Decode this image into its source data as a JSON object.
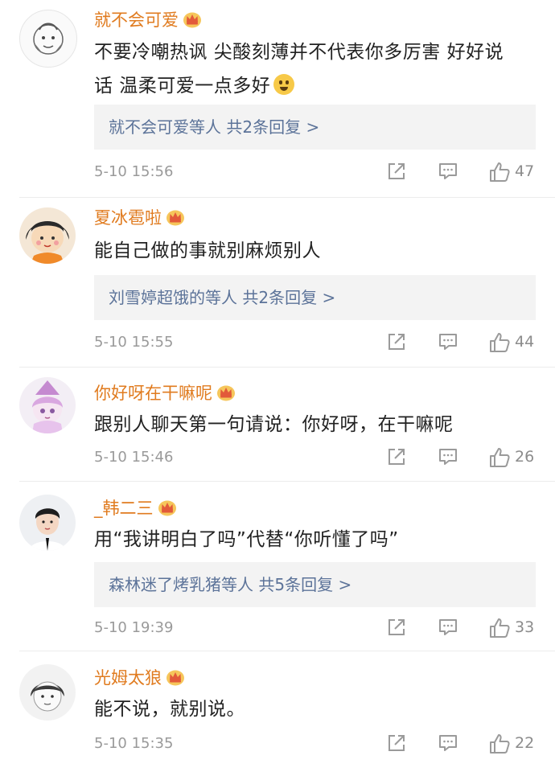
{
  "comments": [
    {
      "username": "就不会可爱",
      "text_line1": "不要冷嘲热讽 尖酸刻薄并不代表你多厉害 好好说",
      "text_line2": "话 温柔可爱一点多好",
      "replies": "就不会可爱等人  共2条回复 >",
      "time": "5-10 15:56",
      "likes": "47",
      "avatar_icon": "doodle-face-avatar"
    },
    {
      "username": "夏冰雹啦",
      "text_line1": "能自己做的事就别麻烦别人",
      "replies": "刘雪婷超饿的等人  共2条回复 >",
      "time": "5-10 15:55",
      "likes": "44",
      "avatar_icon": "cartoon-girl-avatar"
    },
    {
      "username": "你好呀在干嘛呢",
      "text_line1": "跟别人聊天第一句请说：你好呀，在干嘛呢",
      "time": "5-10 15:46",
      "likes": "26",
      "avatar_icon": "anime-character-avatar"
    },
    {
      "username": "_韩二三",
      "text_line1": "用“我讲明白了吗”代替“你听懂了吗”",
      "replies": "森林迷了烤乳猪等人  共5条回复 >",
      "time": "5-10 19:39",
      "likes": "33",
      "avatar_icon": "person-photo-avatar"
    },
    {
      "username": "光姆太狼",
      "text_line1": "能不说，就别说。",
      "time": "5-10 15:35",
      "likes": "22",
      "avatar_icon": "sketch-avatar"
    }
  ],
  "colors": {
    "username": "#e07b1f",
    "reply_link": "#5c7399",
    "reply_bg": "#f3f3f3",
    "meta": "#9a9a9a"
  },
  "icons": [
    "vip-crown-badge",
    "share-icon",
    "comment-icon",
    "like-icon",
    "crying-laughing-emoji"
  ]
}
